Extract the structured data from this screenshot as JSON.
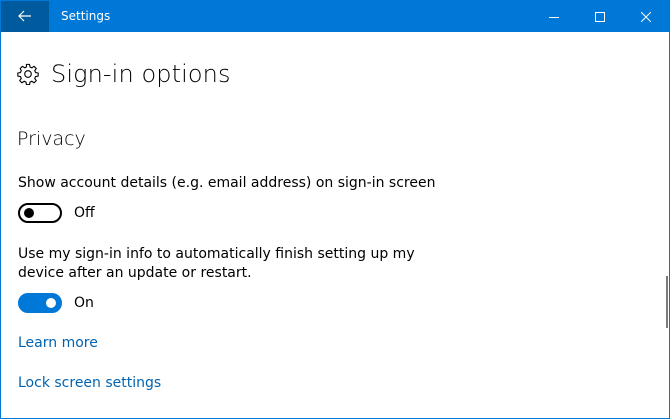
{
  "window": {
    "title": "Settings",
    "accent": "#0078d7"
  },
  "titlebar": {
    "back_icon": "back-arrow-icon",
    "min_icon": "minimize-icon",
    "max_icon": "maximize-icon",
    "close_icon": "close-icon"
  },
  "page": {
    "icon": "gear-icon",
    "title": "Sign-in options"
  },
  "privacy": {
    "heading": "Privacy",
    "account_details": {
      "label": "Show account details (e.g. email address) on sign-in screen",
      "state": "Off",
      "enabled": false
    },
    "signin_info": {
      "label": "Use my sign-in info to automatically finish setting up my device after an update or restart.",
      "state": "On",
      "enabled": true
    }
  },
  "links": {
    "learn_more": "Learn more",
    "lock_screen": "Lock screen settings"
  },
  "colors": {
    "link": "#0063b1",
    "titlebar": "#0078d7",
    "back_button": "#005a9e"
  }
}
